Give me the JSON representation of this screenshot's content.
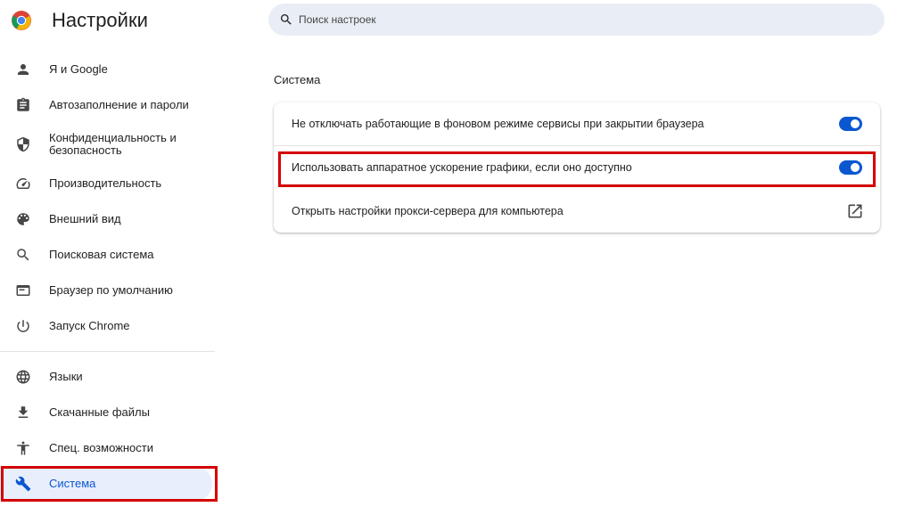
{
  "header": {
    "title": "Настройки",
    "logo_icon": "chrome-logo-icon",
    "search_placeholder": "Поиск настроек"
  },
  "sidebar": {
    "items": [
      {
        "label": "Я и Google",
        "icon": "person-icon"
      },
      {
        "label": "Автозаполнение и пароли",
        "icon": "clipboard-icon"
      },
      {
        "label": "Конфиденциальность и безопасность",
        "icon": "shield-icon"
      },
      {
        "label": "Производительность",
        "icon": "speedometer-icon"
      },
      {
        "label": "Внешний вид",
        "icon": "palette-icon"
      },
      {
        "label": "Поисковая система",
        "icon": "search-icon"
      },
      {
        "label": "Браузер по умолчанию",
        "icon": "browser-window-icon"
      },
      {
        "label": "Запуск Chrome",
        "icon": "power-icon"
      },
      {
        "label": "Языки",
        "icon": "globe-icon"
      },
      {
        "label": "Скачанные файлы",
        "icon": "download-icon"
      },
      {
        "label": "Спец. возможности",
        "icon": "accessibility-icon"
      },
      {
        "label": "Система",
        "icon": "wrench-icon",
        "active": true
      }
    ]
  },
  "main": {
    "section_title": "Система",
    "rows": [
      {
        "label": "Не отключать работающие в фоновом режиме сервисы при закрытии браузера",
        "control": "toggle",
        "on": true
      },
      {
        "label": "Использовать аппаратное ускорение графики, если оно доступно",
        "control": "toggle",
        "on": true
      },
      {
        "label": "Открыть настройки прокси-сервера для компьютера",
        "control": "external-link-icon"
      }
    ]
  },
  "colors": {
    "accent": "#0b57d0",
    "active_bg": "#e8eefc",
    "highlight": "#d40000",
    "search_bg": "#e9eef6"
  }
}
